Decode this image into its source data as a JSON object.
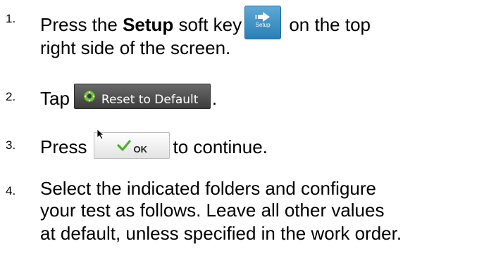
{
  "steps": [
    {
      "number": "1.",
      "line1_pre": "Press the ",
      "line1_bold": "Setup",
      "line1_mid": " soft key",
      "line1_post": " on the top",
      "line2": "right side of the screen."
    },
    {
      "number": "2.",
      "text_pre": "Tap",
      "text_post": "."
    },
    {
      "number": "3.",
      "text_pre": "Press",
      "text_post": "to continue."
    },
    {
      "number": "4.",
      "line1": "Select the indicated folders and configure",
      "line2": "your test as follows.  Leave all other values",
      "line3": "at default, unless specified in the work order."
    }
  ],
  "setup_key": {
    "label": "Setup",
    "icon": "arrow-right-icon",
    "color": "#3b8fc4"
  },
  "reset_button": {
    "label": "Reset to Default",
    "icon": "reset-gear-icon"
  },
  "ok_button": {
    "label": "OK",
    "icon": "checkmark-icon"
  }
}
